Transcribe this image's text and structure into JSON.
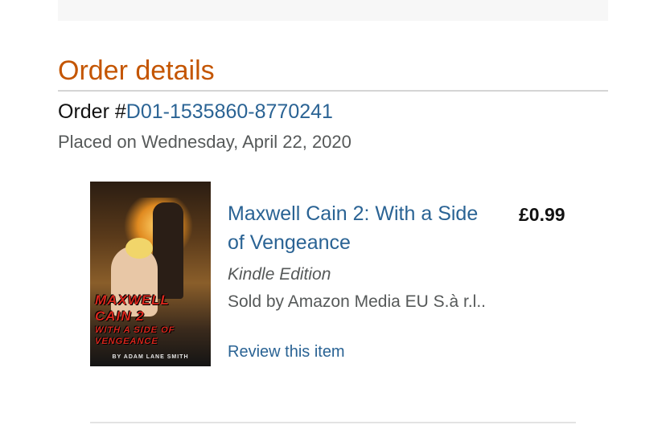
{
  "order": {
    "heading": "Order details",
    "number_prefix": "Order #",
    "number": "D01-1535860-8770241",
    "placed": "Placed on Wednesday, April 22, 2020"
  },
  "item": {
    "title": "Maxwell Cain 2: With a Side of Vengeance",
    "price": "£0.99",
    "edition": "Kindle Edition",
    "sold_by": "Sold by Amazon Media EU S.à r.l..",
    "review_link": "Review this item",
    "cover": {
      "title_line1": "MAXWELL CAIN 2",
      "title_line2": "WITH A SIDE OF VENGEANCE",
      "author": "BY ADAM LANE SMITH"
    }
  },
  "colors": {
    "heading": "#c45500",
    "link": "#2a6394",
    "secondary_text": "#565959"
  }
}
